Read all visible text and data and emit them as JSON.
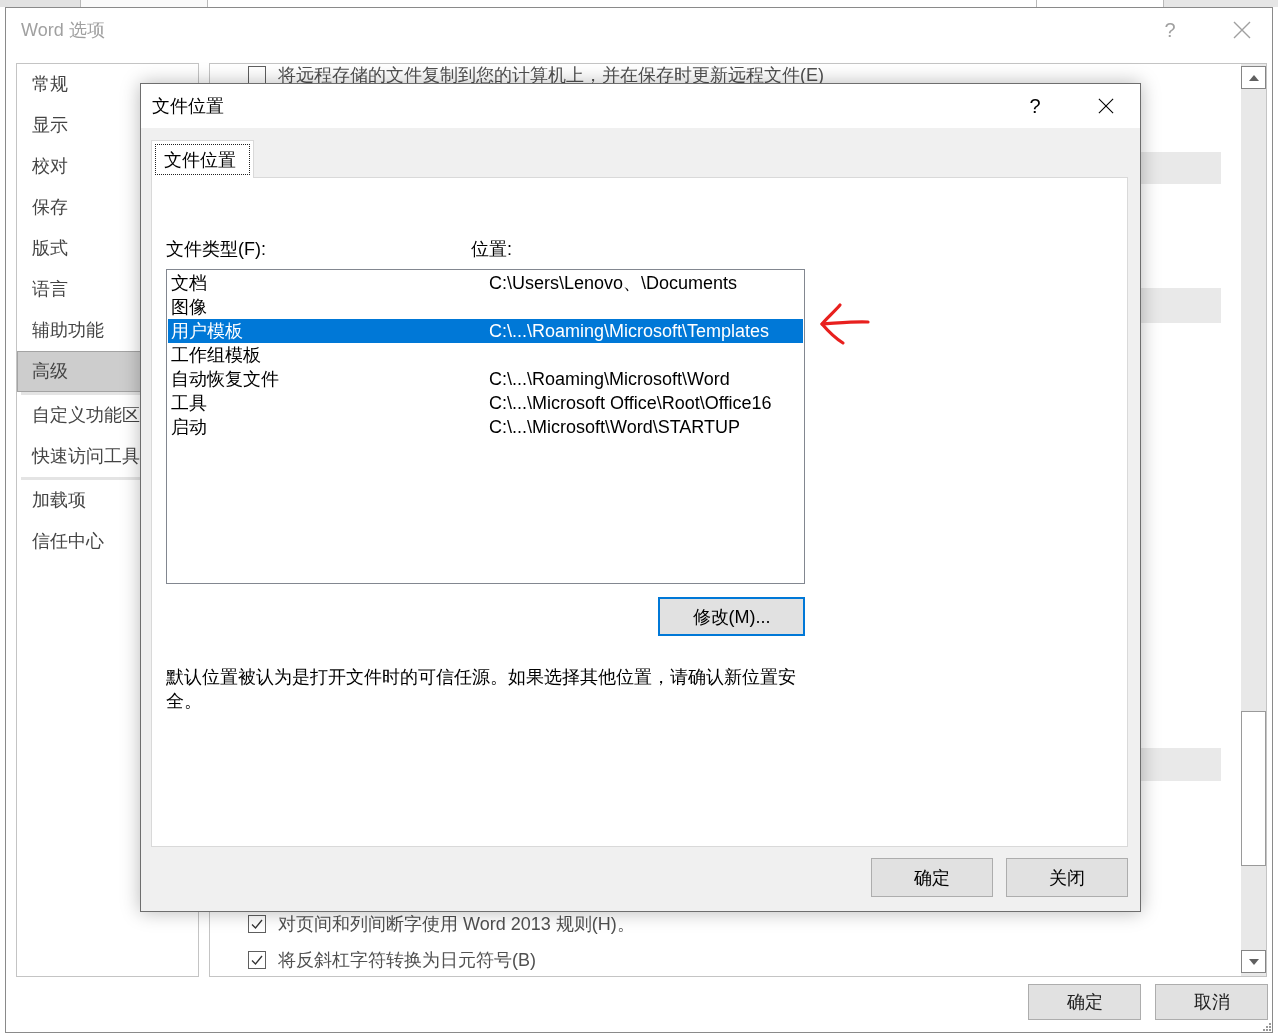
{
  "window": {
    "title": "Word 选项",
    "help": "?"
  },
  "sidebar": {
    "groups": [
      {
        "items": [
          {
            "label": "常规",
            "selected": false
          },
          {
            "label": "显示",
            "selected": false
          },
          {
            "label": "校对",
            "selected": false
          },
          {
            "label": "保存",
            "selected": false
          },
          {
            "label": "版式",
            "selected": false
          },
          {
            "label": "语言",
            "selected": false
          },
          {
            "label": "辅助功能",
            "selected": false
          },
          {
            "label": "高级",
            "selected": true
          }
        ]
      },
      {
        "items": [
          {
            "label": "自定义功能区",
            "selected": false
          },
          {
            "label": "快速访问工具",
            "selected": false
          }
        ]
      },
      {
        "items": [
          {
            "label": "加载项",
            "selected": false
          },
          {
            "label": "信任中心",
            "selected": false
          }
        ]
      }
    ]
  },
  "options": {
    "top": [
      {
        "label": "将远程存储的文件复制到您的计算机上，并在保存时更新远程文件(E)",
        "checked": false
      }
    ],
    "bottom": [
      {
        "label": "对页间和列间断字使用 Word 2013 规则(H)。",
        "checked": true
      },
      {
        "label": "将反斜杠字符转换为日元符号(B)",
        "checked": true
      }
    ]
  },
  "buttons": [
    {
      "label": "确定"
    },
    {
      "label": "取消"
    }
  ],
  "dialog": {
    "title": "文件位置",
    "help": "?",
    "tabs": [
      {
        "label": "文件位置",
        "selected": true
      }
    ],
    "columns": [
      {
        "label": "文件类型(F):"
      },
      {
        "label": "位置:"
      }
    ],
    "rows": [
      {
        "type": "文档",
        "location": "C:\\Users\\Lenovo、\\Documents",
        "selected": false,
        "arrow_marked": false
      },
      {
        "type": "图像",
        "selected": false,
        "arrow_marked": false
      },
      {
        "type": "用户模板",
        "location": "C:\\...\\Roaming\\Microsoft\\Templates",
        "selected": true,
        "arrow_marked": true
      },
      {
        "type": "工作组模板",
        "selected": false,
        "arrow_marked": false
      },
      {
        "type": "自动恢复文件",
        "location": "C:\\...\\Roaming\\Microsoft\\Word",
        "selected": false,
        "arrow_marked": false
      },
      {
        "type": "工具",
        "location": "C:\\...\\Microsoft Office\\Root\\Office16",
        "selected": false,
        "arrow_marked": false
      },
      {
        "type": "启动",
        "location": "C:\\...\\Microsoft\\Word\\STARTUP",
        "selected": false,
        "arrow_marked": false
      }
    ],
    "modify_button": {
      "label": "修改(M)...",
      "focused": true
    },
    "note": "默认位置被认为是打开文件时的可信任源。如果选择其他位置，请确认新位置安全。",
    "buttons": [
      {
        "label": "确定"
      },
      {
        "label": "关闭"
      }
    ]
  }
}
